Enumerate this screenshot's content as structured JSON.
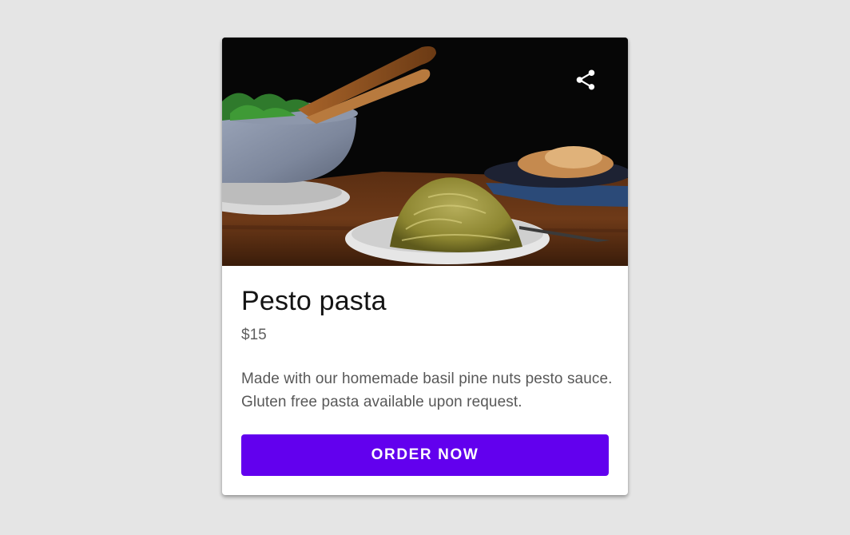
{
  "card": {
    "image_alt": "Plate of pesto spaghetti on a wooden table",
    "share_icon": "share-icon",
    "title": "Pesto pasta",
    "price": "$15",
    "description": "Made with our homemade basil pine nuts pesto sauce. Gluten free pasta available upon request.",
    "order_button_label": "ORDER NOW"
  },
  "colors": {
    "accent": "#6200ee",
    "background": "#e5e5e5",
    "card": "#ffffff"
  }
}
